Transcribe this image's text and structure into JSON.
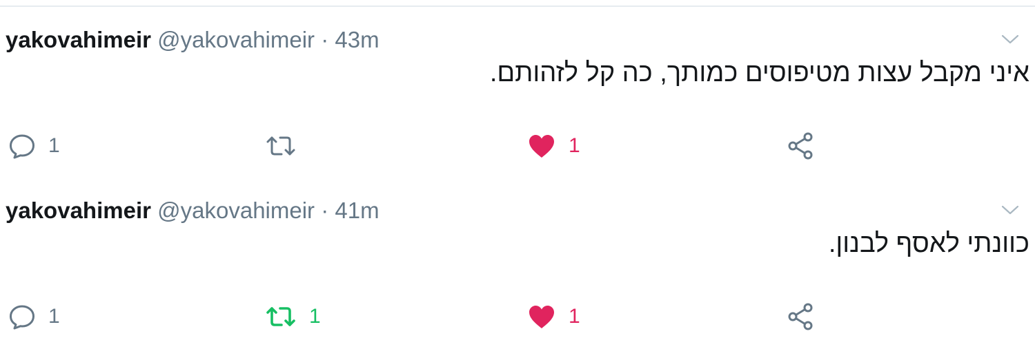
{
  "colors": {
    "text_primary": "#14171a",
    "text_secondary": "#657786",
    "like_active": "#e0245e",
    "retweet_active": "#17bf63",
    "divider": "#e6ecf0"
  },
  "tweets": [
    {
      "name": "yakovahimeir",
      "handle": "@yakovahimeir",
      "separator": "·",
      "time": "43m",
      "text": "איני מקבל עצות מטיפוסים כמותך, כה קל לזהותם.",
      "actions": {
        "reply_count": "1",
        "retweet_count": "",
        "retweeted": false,
        "like_count": "1",
        "liked": true
      }
    },
    {
      "name": "yakovahimeir",
      "handle": "@yakovahimeir",
      "separator": "·",
      "time": "41m",
      "text": "כוונתי לאסף לבנון.",
      "actions": {
        "reply_count": "1",
        "retweet_count": "1",
        "retweeted": true,
        "like_count": "1",
        "liked": true
      }
    }
  ]
}
